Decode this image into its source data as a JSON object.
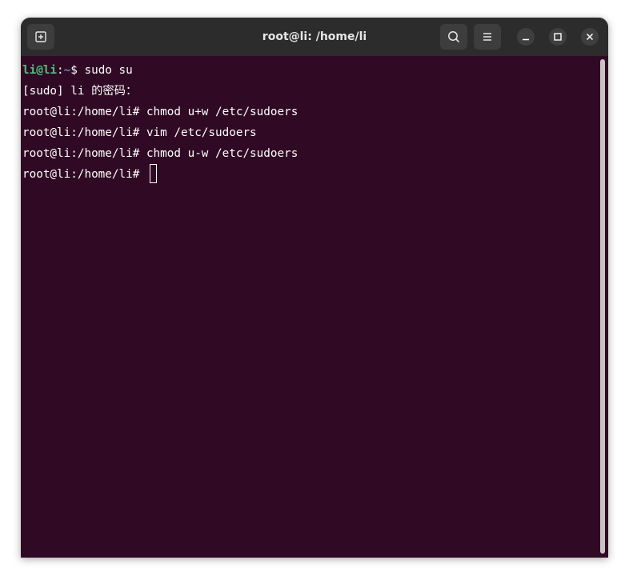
{
  "window": {
    "title": "root@li: /home/li"
  },
  "titlebar": {
    "new_tab_icon": "new-tab-icon",
    "search_icon": "search-icon",
    "menu_icon": "hamburger-menu-icon",
    "minimize_icon": "minimize-icon",
    "maximize_icon": "maximize-icon",
    "close_icon": "close-icon"
  },
  "terminal": {
    "line1": {
      "user": "li@li",
      "colon": ":",
      "path": "~",
      "prompt_char": "$ ",
      "command": "sudo su"
    },
    "line2": {
      "text": "[sudo] li 的密码："
    },
    "root_prompt": "root@li:/home/li# ",
    "line3_command": "chmod u+w /etc/sudoers",
    "line4_command": "vim /etc/sudoers",
    "line5_command": "chmod u-w /etc/sudoers",
    "line6_command": ""
  },
  "colors": {
    "background": "#300a24",
    "titlebar": "#2c2c2c",
    "user_prompt": "#4fbf7f",
    "path_prompt": "#6e86c9",
    "text": "#ffffff"
  }
}
